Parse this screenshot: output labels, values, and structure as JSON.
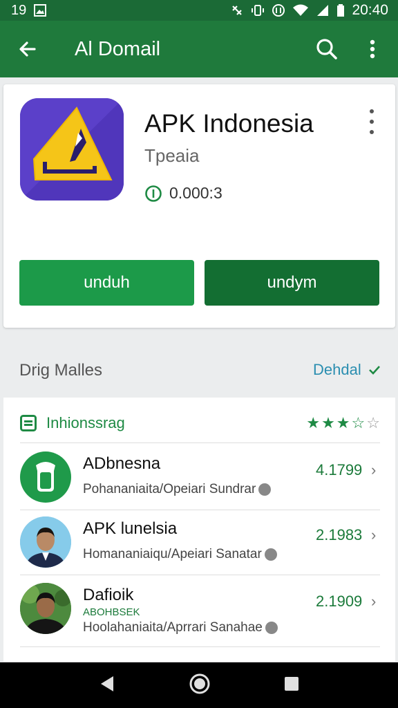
{
  "status_bar": {
    "left_icons": [
      "sim-icon",
      "image-icon"
    ],
    "left_text": "19",
    "right_icons": [
      "nfc-icon",
      "vibrate-icon",
      "data-icon",
      "wifi-icon",
      "signal-icon",
      "battery-icon"
    ],
    "time": "20:40"
  },
  "app_bar": {
    "title": "Al Domail",
    "back_icon": "arrow-back-icon",
    "search_icon": "search-icon",
    "menu_icon": "more-vert-icon"
  },
  "app": {
    "name": "APK Indonesia",
    "subtitle": "Tpeaia",
    "size": "0.000:3",
    "button_primary": "unduh",
    "button_secondary": "undym"
  },
  "section": {
    "title": "Drig Malles",
    "link": "Dehdal"
  },
  "list": {
    "header_label": "Inhionssrag",
    "rating_stars": 3.5,
    "items": [
      {
        "name": "ADbnesna",
        "desc": "Pohananiaita/Opeiari Sundrar",
        "value": "4.1799"
      },
      {
        "name": "APK lunelsia",
        "desc": "Homananiaiqu/Apeiari Sanatar",
        "value": "2.1983"
      },
      {
        "name": "Dafioik",
        "small": "ABOHBSEK",
        "desc": "Hoolahaniaita/Aprrari Sanahae",
        "value": "2.1909"
      }
    ]
  },
  "colors": {
    "app_bar": "#1f7a3c",
    "status_bar": "#1b6a36",
    "button_primary": "#1c9a49",
    "button_secondary": "#136e32",
    "icon_purple": "#5a3fc6",
    "icon_yellow": "#f5c518",
    "link": "#2a8eb0"
  }
}
